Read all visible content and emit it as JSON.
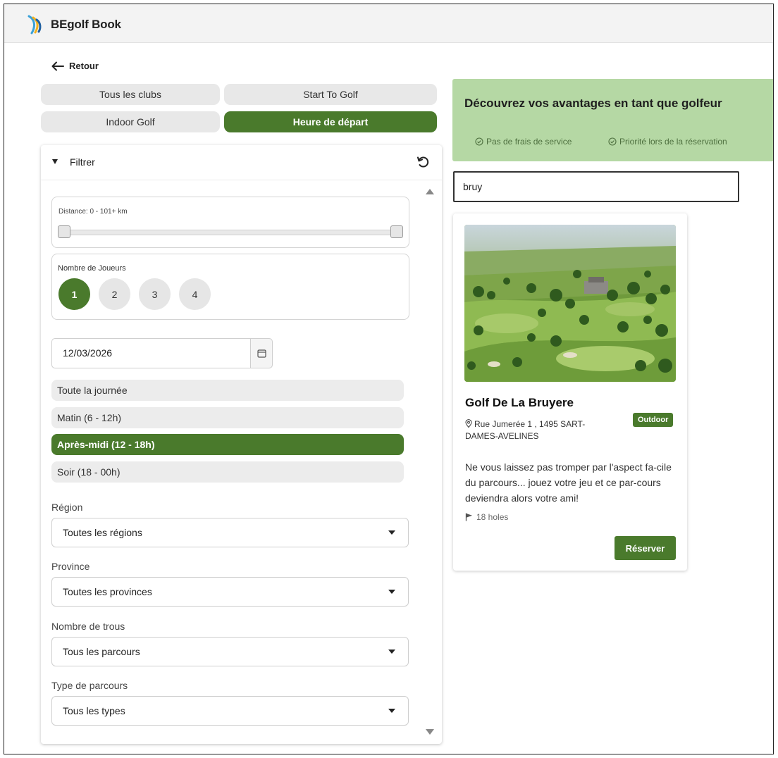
{
  "app": {
    "title": "BEgolf Book"
  },
  "nav": {
    "back_label": "Retour"
  },
  "tabs": [
    {
      "label": "Tous les clubs",
      "active": false
    },
    {
      "label": "Start To Golf",
      "active": false
    },
    {
      "label": "Indoor Golf",
      "active": false
    },
    {
      "label": "Heure de départ",
      "active": true
    }
  ],
  "filter": {
    "title": "Filtrer",
    "distance_label": "Distance:  0 - 101+ km",
    "players_label": "Nombre de Joueurs",
    "players": [
      "1",
      "2",
      "3",
      "4"
    ],
    "players_selected": "1",
    "date_value": "12/03/2026",
    "time_options": [
      {
        "label": "Toute la journée",
        "active": false
      },
      {
        "label": "Matin (6 - 12h)",
        "active": false
      },
      {
        "label": "Après-midi (12 - 18h)",
        "active": true
      },
      {
        "label": "Soir (18 - 00h)",
        "active": false
      }
    ],
    "selects": [
      {
        "label": "Région",
        "value": "Toutes les régions"
      },
      {
        "label": "Province",
        "value": "Toutes les provinces"
      },
      {
        "label": "Nombre de trous",
        "value": "Tous les parcours"
      },
      {
        "label": "Type de parcours",
        "value": "Tous les types"
      }
    ]
  },
  "banner": {
    "title": "Découvrez vos avantages en tant que golfeur",
    "item1": "Pas de frais de service",
    "item2": "Priorité lors de la réservation"
  },
  "search": {
    "value": "bruy"
  },
  "result": {
    "name": "Golf De La Bruyere",
    "badge": "Outdoor",
    "address": "Rue Jumerée 1 , 1495 SART-DAMES-AVELINES",
    "description": "Ne vous laissez pas tromper par l'aspect fa-cile du parcours... jouez votre jeu et ce par-cours deviendra alors votre ami!",
    "holes": "18 holes",
    "reserve_label": "Réserver"
  },
  "colors": {
    "accent": "#4a7a2c",
    "banner": "#b5d8a4"
  }
}
